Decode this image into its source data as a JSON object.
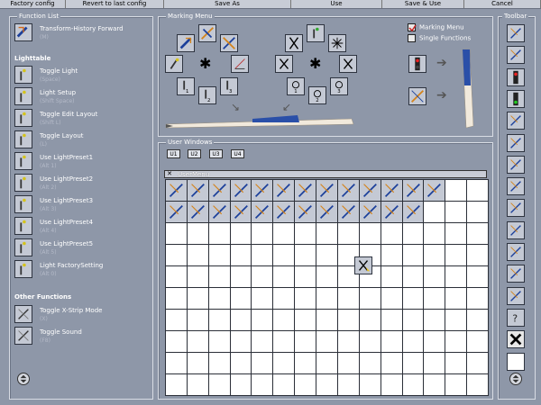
{
  "menubar": [
    "Factory config",
    "Revert to last config",
    "Save As",
    "Use",
    "Save & Use",
    "Cancel"
  ],
  "function_list": {
    "title": "Function List",
    "top_item": {
      "label": "Transform-History Forward",
      "key": "(M)",
      "icon": "transform-history-icon"
    },
    "lighttable_heading": "Lighttable",
    "lighttable_items": [
      {
        "label": "Toggle Light",
        "key": "(Space)",
        "icon": "light-icon"
      },
      {
        "label": "Light Setup",
        "key": "(Shift Space)",
        "icon": "light-setup-icon"
      },
      {
        "label": "Toggle Edit Layout",
        "key": "(Shift L)",
        "icon": "edit-layout-icon"
      },
      {
        "label": "Toggle Layout",
        "key": "(L)",
        "icon": "layout-icon"
      },
      {
        "label": "Use LightPreset1",
        "key": "(Alt 1)",
        "icon": "light-preset-1-icon"
      },
      {
        "label": "Use LightPreset2",
        "key": "(Alt 2)",
        "icon": "light-preset-2-icon"
      },
      {
        "label": "Use LightPreset3",
        "key": "(Alt 3)",
        "icon": "light-preset-3-icon"
      },
      {
        "label": "Use LightPreset4",
        "key": "(Alt 4)",
        "icon": "light-preset-4-icon"
      },
      {
        "label": "Use LightPreset5",
        "key": "(Alt 5)",
        "icon": "light-preset-5-icon"
      },
      {
        "label": "Light FactorySetting",
        "key": "(Alt 0)",
        "icon": "light-factory-icon"
      }
    ],
    "other_heading": "Other Functions",
    "other_items": [
      {
        "label": "Toggle X-Strip Mode",
        "key": "(X)",
        "icon": "x-strip-icon"
      },
      {
        "label": "Toggle Sound",
        "key": "(F8)",
        "icon": "sound-icon"
      }
    ]
  },
  "marking_menu": {
    "title": "Marking Menu",
    "options": [
      {
        "label": "Marking Menu",
        "checked": true
      },
      {
        "label": "Single Functions",
        "checked": false
      }
    ]
  },
  "user_windows": {
    "title": "User Windows",
    "tabs": [
      "U1",
      "U2",
      "U3",
      "U4"
    ],
    "window_title": "UserMenu",
    "row1_icons": [
      "move-icon",
      "rotate-icon",
      "help-icon",
      "help-icon",
      "help-icon",
      "help-icon",
      "star-icon",
      "light-icon",
      "preset-1-icon",
      "preset-2-icon",
      "preset-3-icon",
      "film-strip-icon",
      "hourglass-icon"
    ],
    "row2_icons": [
      "edit-icon",
      "edit-icon",
      "edit-icon",
      "light-setup-icon",
      "layout-icon",
      "layout-icon",
      "edit-icon",
      "preset-1-icon",
      "preset-2-icon",
      "preset-3-icon",
      "undo-icon",
      "film-frame-icon"
    ],
    "grid_cols": 15,
    "grid_rows": 10
  },
  "toolbar": {
    "title": "Toolbar",
    "icons": [
      "edit-icon",
      "edit-icon",
      "traffic-light-red-icon",
      "traffic-light-green-icon",
      "layout-icon",
      "layout-icon",
      "move-icon",
      "redo-icon",
      "undo-icon",
      "skip-forward-icon",
      "skip-back-icon",
      "sound-icon",
      "floppy-icon",
      "help-icon",
      "close-icon",
      "empty-slot"
    ]
  },
  "colors": {
    "background": "#8e97a8",
    "icon_face": "#c4c9d4",
    "pen_blue": "#2a4fa8",
    "check_red": "#cc2222"
  }
}
